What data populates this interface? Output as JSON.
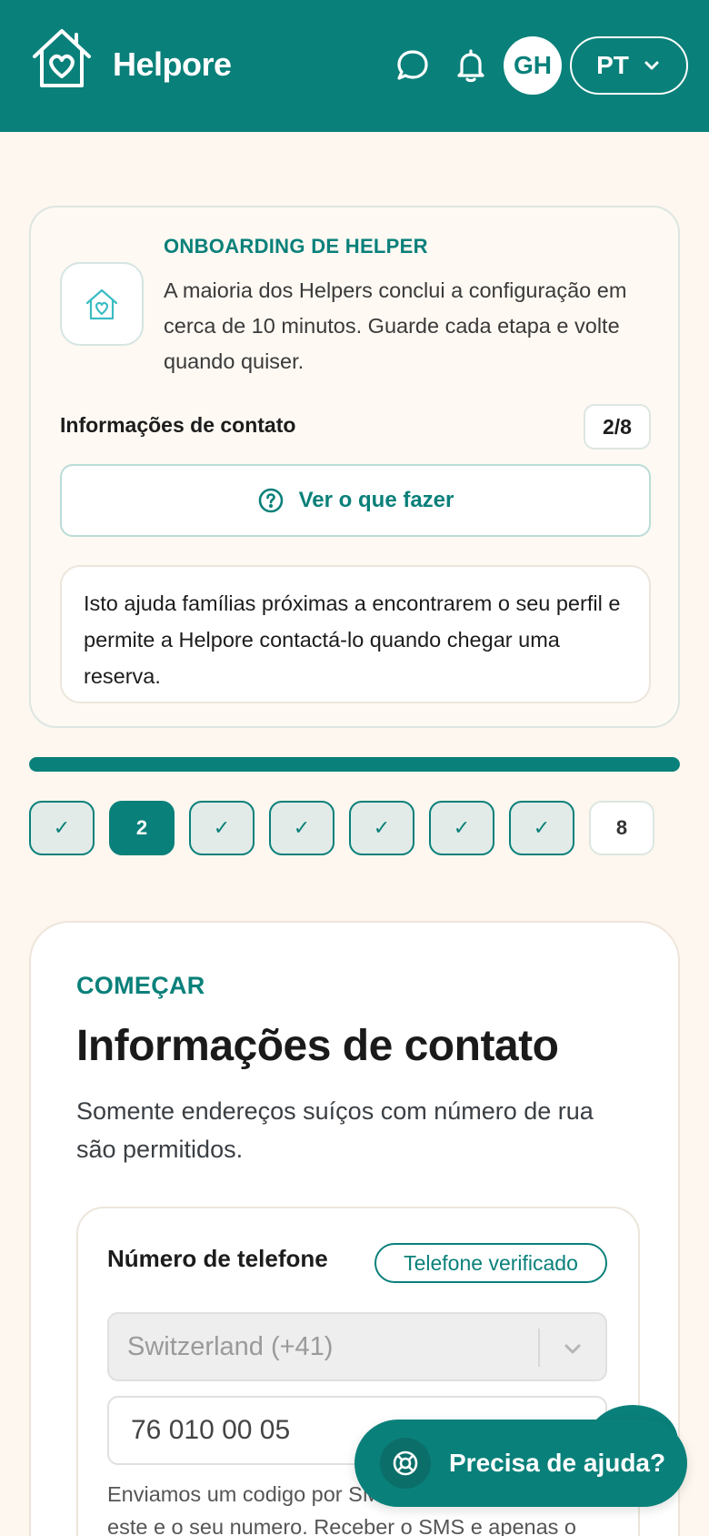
{
  "header": {
    "brand": "Helpore",
    "avatar_initials": "GH",
    "language": "PT",
    "icons": [
      "house-heart-icon",
      "chat-bubble-icon",
      "bell-icon",
      "chevron-down-icon"
    ]
  },
  "onboarding": {
    "eyebrow": "ONBOARDING DE HELPER",
    "description": "A maioria dos Helpers conclui a configuração em cerca de 10 minutos. Guarde cada etapa e volte quando quiser.",
    "step_name": "Informações de contato",
    "step_count": "2/8",
    "todo_button": "Ver o que fazer",
    "info": "Isto ajuda famílias próximas a encontrarem o seu perfil e permite a Helpore contactá-lo quando chegar uma reserva."
  },
  "progress": {
    "fraction": 1.0,
    "steps": [
      {
        "label": "✓",
        "state": "done"
      },
      {
        "label": "2",
        "state": "current"
      },
      {
        "label": "✓",
        "state": "done"
      },
      {
        "label": "✓",
        "state": "done"
      },
      {
        "label": "✓",
        "state": "done"
      },
      {
        "label": "✓",
        "state": "done"
      },
      {
        "label": "✓",
        "state": "done"
      },
      {
        "label": "8",
        "state": "pending"
      }
    ]
  },
  "form": {
    "eyebrow": "COMEÇAR",
    "title": "Informações de contato",
    "subtitle": "Somente endereços suíços com número de rua são permitidos.",
    "phone_label": "Número de telefone",
    "verified_badge": "Telefone verificado",
    "country_value": "Switzerland (+41)",
    "phone_value": "76 010 00 05",
    "sms_note": "Enviamos um codigo por SMS para confirmar que este e o seu numero. Receber o SMS e apenas o primeiro passo: introduza o codigo"
  },
  "help": {
    "label": "Precisa de ajuda?"
  },
  "colors": {
    "brand": "#0a807a",
    "background": "#fdf7f0"
  }
}
